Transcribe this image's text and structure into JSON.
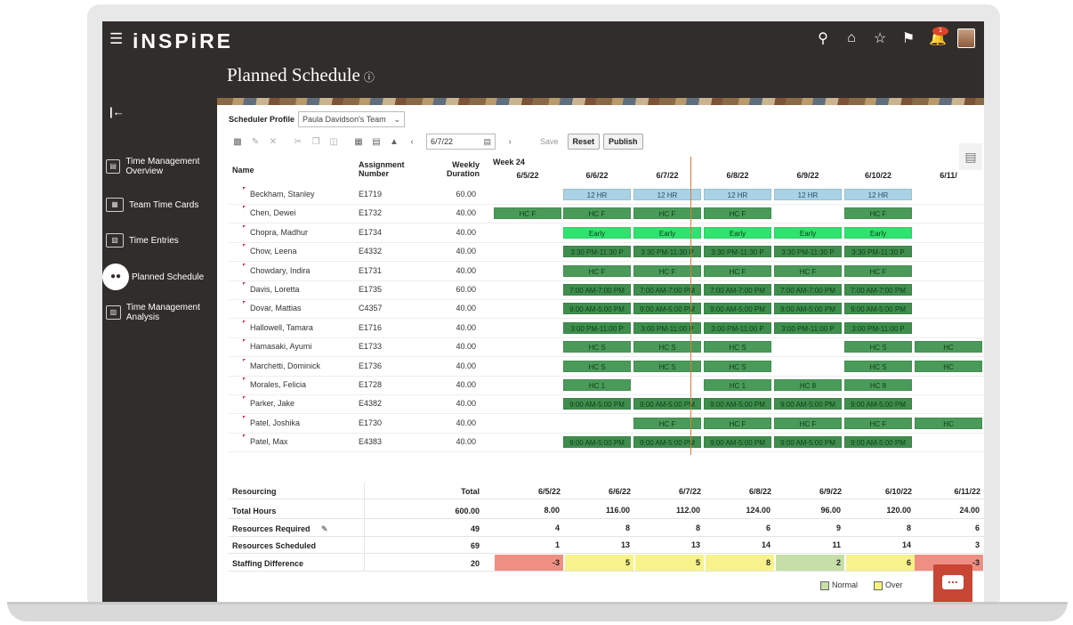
{
  "app": {
    "logo": "iNSPiRE",
    "menu_icon": "hamburger-icon"
  },
  "header": {
    "title": "Planned Schedule",
    "help_glyph": "?",
    "icons": [
      "search-icon",
      "home-icon",
      "star-icon",
      "flag-icon",
      "bell-icon",
      "avatar"
    ],
    "notification_count": "1"
  },
  "sidebar": {
    "items": [
      {
        "label": "Time Management Overview",
        "icon": "overview-icon",
        "active": false
      },
      {
        "label": "Team Time Cards",
        "icon": "timecards-icon",
        "active": false
      },
      {
        "label": "Time Entries",
        "icon": "entries-icon",
        "active": false
      },
      {
        "label": "Planned Schedule",
        "icon": "team-schedule-icon",
        "active": true
      },
      {
        "label": "Time Management Analysis",
        "icon": "analysis-icon",
        "active": false
      }
    ]
  },
  "scheduler": {
    "profile_label": "Scheduler Profile",
    "profile_value": "Paula Davidson's Team"
  },
  "toolbar": {
    "date": "6/7/22",
    "save_label": "Save",
    "reset_label": "Reset",
    "publish_label": "Publish"
  },
  "grid": {
    "col_name": "Name",
    "col_assignment": "Assignment Number",
    "col_duration": "Weekly Duration",
    "week_label": "Week 24",
    "dates": [
      "6/5/22",
      "6/6/22",
      "6/7/22",
      "6/8/22",
      "6/9/22",
      "6/10/22",
      "6/11/"
    ],
    "rows": [
      {
        "name": "Beckham, Stanley",
        "num": "E1719",
        "dur": "60.00",
        "shifts": [
          "",
          "12 HR",
          "12 HR",
          "12 HR",
          "12 HR",
          "12 HR",
          ""
        ]
      },
      {
        "name": "Chen, Dewei",
        "num": "E1732",
        "dur": "40.00",
        "shifts": [
          "HC F",
          "HC F",
          "HC F",
          "HC F",
          "",
          "HC F",
          ""
        ]
      },
      {
        "name": "Chopra, Madhur",
        "num": "E1734",
        "dur": "40.00",
        "shifts": [
          "",
          "Early",
          "Early",
          "Early",
          "Early",
          "Early",
          ""
        ]
      },
      {
        "name": "Chow, Leena",
        "num": "E4332",
        "dur": "40.00",
        "shifts": [
          "",
          "3:30 PM-11:30 P",
          "3:30 PM-11:30 P",
          "3:30 PM-11:30 P",
          "3:30 PM-11:30 P",
          "3:30 PM-11:30 P",
          ""
        ]
      },
      {
        "name": "Chowdary, Indira",
        "num": "E1731",
        "dur": "40.00",
        "shifts": [
          "",
          "HC F",
          "HC F",
          "HC F",
          "HC F",
          "HC F",
          ""
        ]
      },
      {
        "name": "Davis, Loretta",
        "num": "E1735",
        "dur": "60.00",
        "shifts": [
          "",
          "7:00 AM-7:00 PM",
          "7:00 AM-7:00 PM",
          "7:00 AM-7:00 PM",
          "7:00 AM-7:00 PM",
          "7:00 AM-7:00 PM",
          ""
        ]
      },
      {
        "name": "Dovar, Mattias",
        "num": "C4357",
        "dur": "40.00",
        "shifts": [
          "",
          "9:00 AM-5:00 PM",
          "9:00 AM-5:00 PM",
          "9:00 AM-5:00 PM",
          "9:00 AM-5:00 PM",
          "9:00 AM-5:00 PM",
          ""
        ]
      },
      {
        "name": "Hallowell, Tamara",
        "num": "E1716",
        "dur": "40.00",
        "shifts": [
          "",
          "3:00 PM-11:00 P",
          "3:00 PM-11:00 P",
          "3:00 PM-11:00 P",
          "3:00 PM-11:00 P",
          "3:00 PM-11:00 P",
          ""
        ]
      },
      {
        "name": "Hamasaki, Ayumi",
        "num": "E1733",
        "dur": "40.00",
        "shifts": [
          "",
          "HC S",
          "HC S",
          "HC S",
          "",
          "HC S",
          "HC"
        ]
      },
      {
        "name": "Marchetti, Dominick",
        "num": "E1736",
        "dur": "40.00",
        "shifts": [
          "",
          "HC S",
          "HC S",
          "HC S",
          "",
          "HC S",
          "HC"
        ]
      },
      {
        "name": "Morales, Felicia",
        "num": "E1728",
        "dur": "40.00",
        "shifts": [
          "",
          "HC 1",
          "",
          "HC 1",
          "HC 8",
          "HC 8",
          ""
        ]
      },
      {
        "name": "Parker, Jake",
        "num": "E4382",
        "dur": "40.00",
        "shifts": [
          "",
          "9:00 AM-5:00 PM",
          "9:00 AM-5:00 PM",
          "9:00 AM-5:00 PM",
          "9:00 AM-5:00 PM",
          "9:00 AM-5:00 PM",
          ""
        ]
      },
      {
        "name": "Patel, Joshika",
        "num": "E1730",
        "dur": "40.00",
        "shifts": [
          "",
          "",
          "HC F",
          "HC F",
          "HC F",
          "HC F",
          "HC"
        ]
      },
      {
        "name": "Patel, Max",
        "num": "E4383",
        "dur": "40.00",
        "shifts": [
          "",
          "9:00 AM-5:00 PM",
          "9:00 AM-5:00 PM",
          "9:00 AM-5:00 PM",
          "9:00 AM-5:00 PM",
          "9:00 AM-5:00 PM",
          ""
        ]
      }
    ]
  },
  "resourcing": {
    "label": "Resourcing",
    "total_label": "Total",
    "dates": [
      "6/5/22",
      "6/6/22",
      "6/7/22",
      "6/8/22",
      "6/9/22",
      "6/10/22",
      "6/11/22"
    ],
    "rows": [
      {
        "label": "Total Hours",
        "total": "600.00",
        "values": [
          "8.00",
          "116.00",
          "112.00",
          "124.00",
          "96.00",
          "120.00",
          "24.00"
        ]
      },
      {
        "label": "Resources Required",
        "total": "49",
        "values": [
          "4",
          "8",
          "8",
          "6",
          "9",
          "8",
          "6"
        ],
        "editable": true
      },
      {
        "label": "Resources Scheduled",
        "total": "69",
        "values": [
          "1",
          "13",
          "13",
          "14",
          "11",
          "14",
          "3"
        ]
      },
      {
        "label": "Staffing Difference",
        "total": "20",
        "values": [
          "-3",
          "5",
          "5",
          "8",
          "2",
          "6",
          "-3"
        ],
        "status": [
          "under",
          "over",
          "over",
          "over",
          "normal",
          "over",
          "under"
        ]
      }
    ]
  },
  "legend": [
    {
      "label": "Normal",
      "color": "#c9dfa8"
    },
    {
      "label": "Over",
      "color": "#f5f27a"
    }
  ],
  "colors": {
    "hr12": "#a9d2e4",
    "hc": "#4a9a59",
    "early": "#2ee36f",
    "timed": "#3f8e4e",
    "under": "#ef8f84",
    "over": "#f7f38a",
    "normal": "#c6dea7"
  }
}
